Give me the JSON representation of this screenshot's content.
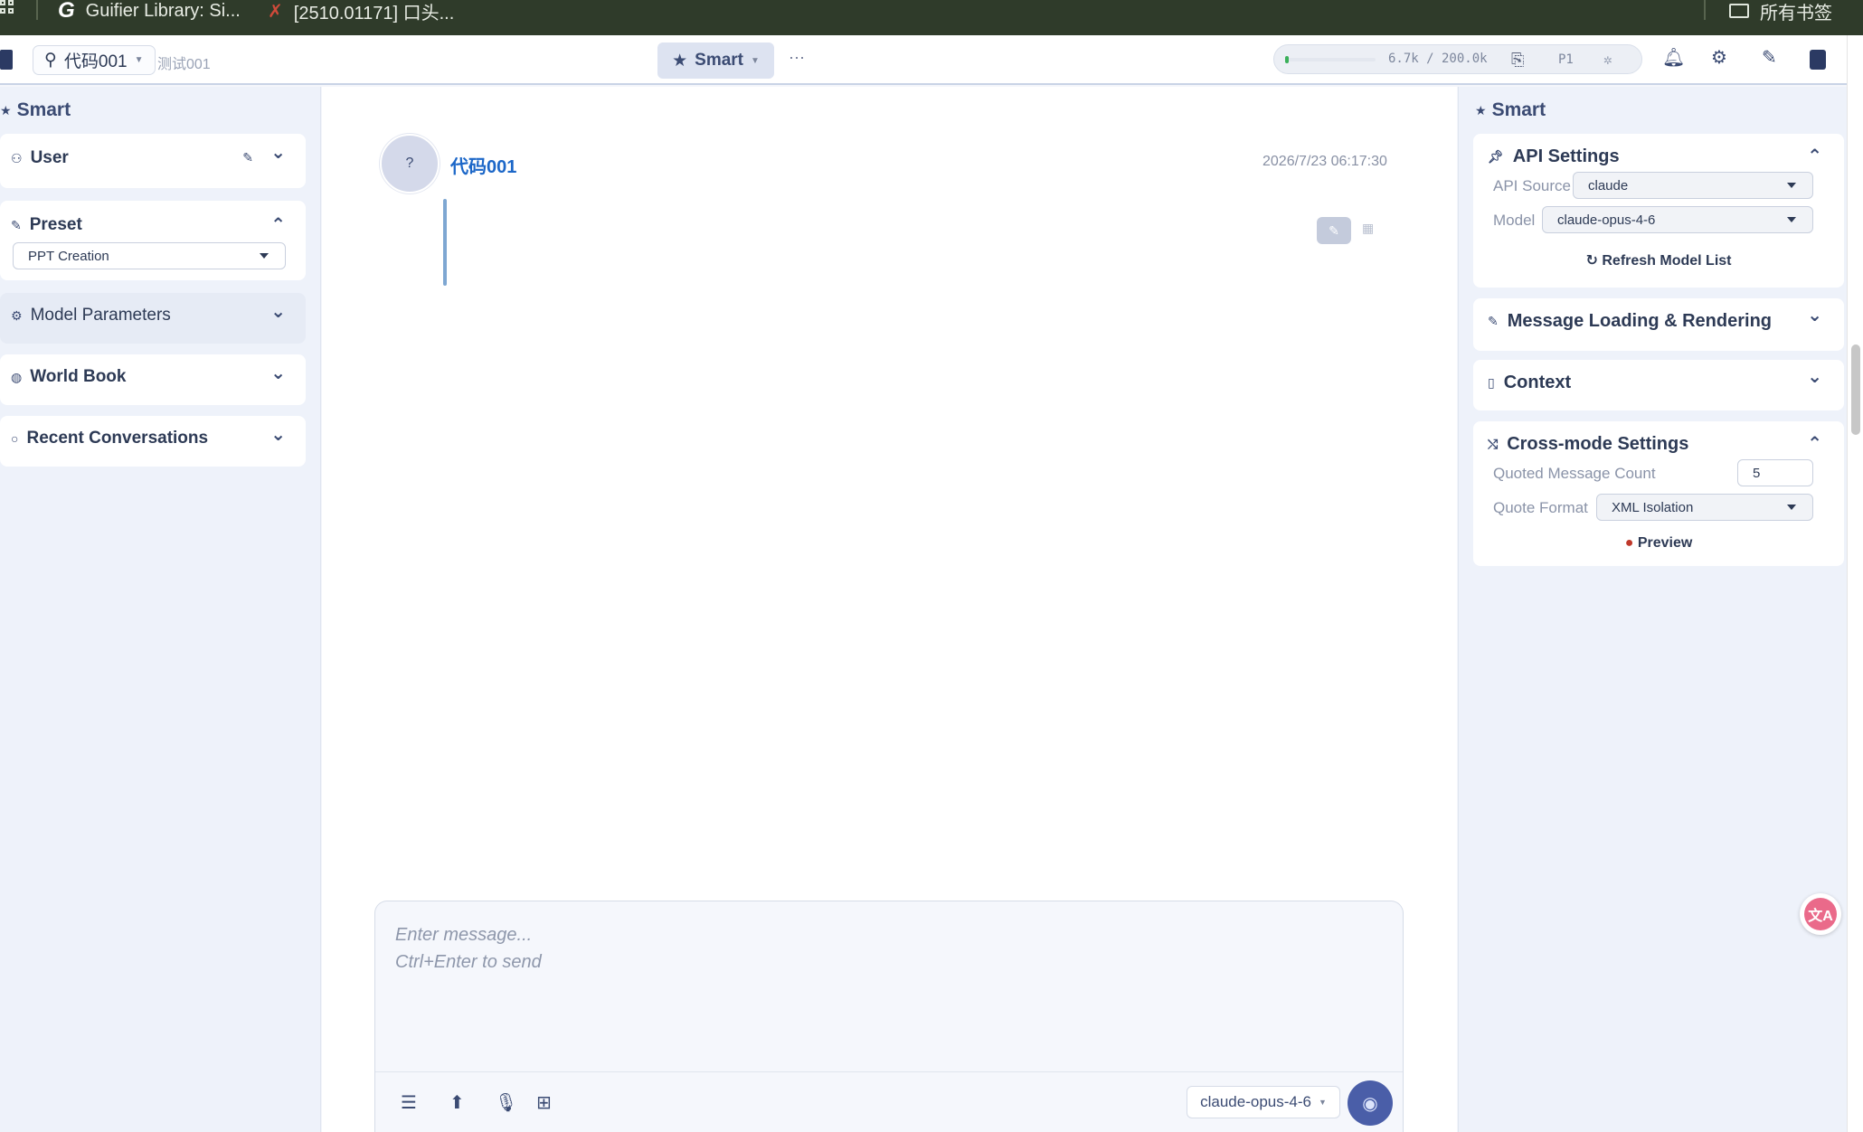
{
  "browser": {
    "bookmarks": [
      {
        "label": "Guifier Library: Si..."
      },
      {
        "label": "[2510.01171] 口头..."
      }
    ],
    "all_bookmarks": "所有书签"
  },
  "topbar": {
    "persona": "代码001",
    "subtitle": "测试001",
    "mode": "Smart",
    "more": "···",
    "tokens": "6.7k / 200.0k",
    "token_progress": 0.0335,
    "page": "P1"
  },
  "left": {
    "title": "Smart",
    "user": {
      "label": "User"
    },
    "preset": {
      "label": "Preset",
      "selected": "PPT Creation"
    },
    "model_params": {
      "label": "Model Parameters"
    },
    "world_book": {
      "label": "World Book"
    },
    "recent": {
      "label": "Recent Conversations"
    }
  },
  "chat": {
    "avatar_char": "?",
    "sender": "代码001",
    "time": "2026/7/23 06:17:30",
    "composer_placeholder": "Enter message...\nCtrl+Enter to send",
    "model": "claude-opus-4-6"
  },
  "right": {
    "title": "Smart",
    "api": {
      "title": "API Settings",
      "source_label": "API Source",
      "source_value": "claude",
      "model_label": "Model",
      "model_value": "claude-opus-4-6",
      "refresh": "Refresh Model List"
    },
    "loading": {
      "title": "Message Loading & Rendering"
    },
    "context": {
      "title": "Context"
    },
    "cross": {
      "title": "Cross-mode Settings",
      "count_label": "Quoted Message Count",
      "count_value": "5",
      "format_label": "Quote Format",
      "format_value": "XML Isolation",
      "preview": "Preview"
    }
  },
  "colors": {
    "accent": "#3b4b73",
    "link": "#1c67c8",
    "send": "#4a5ea8",
    "panel": "#eef2fa"
  }
}
